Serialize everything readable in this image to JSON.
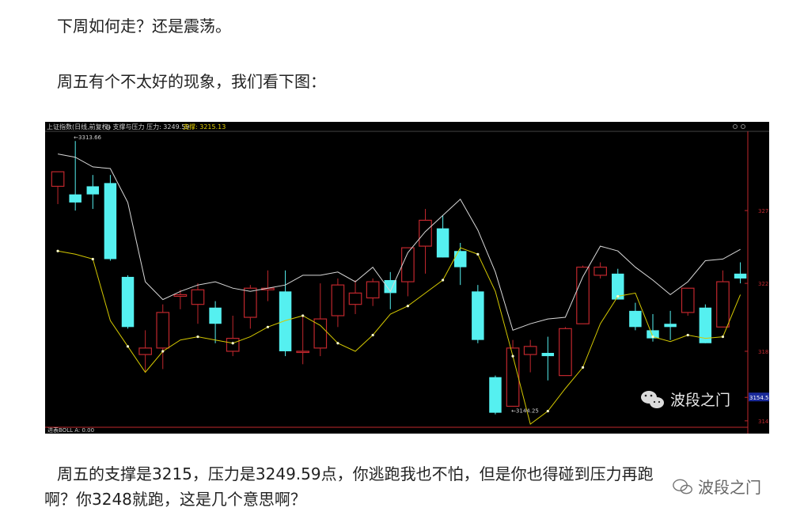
{
  "article": {
    "p1": "下周如何走？还是震荡。",
    "p2": "周五有个不太好的现象，我们看下图：",
    "p3a": "周五的支撑是3215，压力是3249.59点，你逃跑我也不怕，但是你也得碰到压力再跑",
    "p3b": "啊？你3248就跑，这是几个意思啊？"
  },
  "watermark": {
    "chart_label": "波段之门",
    "corner_label": "波段之门",
    "icon": "wechat-icon"
  },
  "chart_header": {
    "index_label": "上证指数(日线,前复权)",
    "indicator": "◎ 支撑与压力 压力: 3249.59",
    "support_label": "支撑: 3215.13",
    "footer_label": "进表BOLL A: 0.00"
  },
  "colors": {
    "background": "#000000",
    "up": "#c0272d",
    "down": "#55f0f0",
    "resistance_line": "#d8d8d8",
    "support_line": "#d4c800",
    "axis": "#c0272d"
  },
  "chart_data": {
    "type": "candlestick",
    "title": "上证指数(日线,前复权)",
    "y_ticks": [
      "327",
      "322",
      "318",
      "3154.5",
      "314"
    ],
    "current_price_label": "3154.5",
    "annotations": [
      {
        "label": "3313.66",
        "near_bar": 1
      },
      {
        "label": "3144.25",
        "near_bar": 26
      }
    ],
    "ylim": [
      3137,
      3318
    ],
    "candles": [
      {
        "o": 3285,
        "h": 3290,
        "l": 3274,
        "c": 3294
      },
      {
        "o": 3280,
        "h": 3313,
        "l": 3270,
        "c": 3275
      },
      {
        "o": 3285,
        "h": 3292,
        "l": 3271,
        "c": 3280
      },
      {
        "o": 3287,
        "h": 3292,
        "l": 3239,
        "c": 3240
      },
      {
        "o": 3229,
        "h": 3230,
        "l": 3197,
        "c": 3198
      },
      {
        "o": 3181,
        "h": 3196,
        "l": 3170,
        "c": 3185
      },
      {
        "o": 3185,
        "h": 3212,
        "l": 3172,
        "c": 3207
      },
      {
        "o": 3217,
        "h": 3221,
        "l": 3209,
        "c": 3218
      },
      {
        "o": 3212,
        "h": 3225,
        "l": 3200,
        "c": 3221
      },
      {
        "o": 3210,
        "h": 3214,
        "l": 3188,
        "c": 3200
      },
      {
        "o": 3183,
        "h": 3205,
        "l": 3180,
        "c": 3191
      },
      {
        "o": 3204,
        "h": 3224,
        "l": 3197,
        "c": 3222
      },
      {
        "o": 3221,
        "h": 3233,
        "l": 3214,
        "c": 3222
      },
      {
        "o": 3220,
        "h": 3233,
        "l": 3180,
        "c": 3183
      },
      {
        "o": 3183,
        "h": 3205,
        "l": 3175,
        "c": 3183
      },
      {
        "o": 3185,
        "h": 3225,
        "l": 3180,
        "c": 3203
      },
      {
        "o": 3205,
        "h": 3228,
        "l": 3198,
        "c": 3224
      },
      {
        "o": 3212,
        "h": 3227,
        "l": 3206,
        "c": 3219
      },
      {
        "o": 3216,
        "h": 3228,
        "l": 3211,
        "c": 3226
      },
      {
        "o": 3227,
        "h": 3232,
        "l": 3209,
        "c": 3219
      },
      {
        "o": 3226,
        "h": 3242,
        "l": 3217,
        "c": 3247
      },
      {
        "o": 3248,
        "h": 3271,
        "l": 3231,
        "c": 3264
      },
      {
        "o": 3259,
        "h": 3267,
        "l": 3243,
        "c": 3241
      },
      {
        "o": 3245,
        "h": 3250,
        "l": 3224,
        "c": 3235
      },
      {
        "o": 3220,
        "h": 3224,
        "l": 3188,
        "c": 3190
      },
      {
        "o": 3167,
        "h": 3168,
        "l": 3144,
        "c": 3145
      },
      {
        "o": 3149,
        "h": 3190,
        "l": 3149,
        "c": 3185
      },
      {
        "o": 3181,
        "h": 3190,
        "l": 3170,
        "c": 3186
      },
      {
        "o": 3182,
        "h": 3192,
        "l": 3165,
        "c": 3180
      },
      {
        "o": 3168,
        "h": 3198,
        "l": 3168,
        "c": 3197
      },
      {
        "o": 3200,
        "h": 3236,
        "l": 3200,
        "c": 3235
      },
      {
        "o": 3230,
        "h": 3238,
        "l": 3228,
        "c": 3235
      },
      {
        "o": 3231,
        "h": 3234,
        "l": 3215,
        "c": 3215
      },
      {
        "o": 3208,
        "h": 3213,
        "l": 3196,
        "c": 3198
      },
      {
        "o": 3196,
        "h": 3206,
        "l": 3189,
        "c": 3191
      },
      {
        "o": 3200,
        "h": 3208,
        "l": 3190,
        "c": 3198
      },
      {
        "o": 3207,
        "h": 3219,
        "l": 3205,
        "c": 3222
      },
      {
        "o": 3210,
        "h": 3212,
        "l": 3190,
        "c": 3188
      },
      {
        "o": 3198,
        "h": 3233,
        "l": 3198,
        "c": 3226
      },
      {
        "o": 3231,
        "h": 3238,
        "l": 3225,
        "c": 3228
      }
    ],
    "resistance_line": [
      3305,
      3303,
      3297,
      3296,
      3275,
      3226,
      3215,
      3220,
      3224,
      3226,
      3222,
      3220,
      3222,
      3224,
      3230,
      3230,
      3232,
      3226,
      3235,
      3220,
      3244,
      3257,
      3267,
      3277,
      3258,
      3232,
      3196,
      3200,
      3203,
      3204,
      3229,
      3248,
      3245,
      3235,
      3227,
      3218,
      3226,
      3239,
      3240,
      3246
    ],
    "support_line": [
      3245,
      3243,
      3240,
      3202,
      3186,
      3170,
      3183,
      3190,
      3192,
      3190,
      3188,
      3192,
      3198,
      3202,
      3205,
      3199,
      3188,
      3183,
      3193,
      3206,
      3211,
      3219,
      3227,
      3247,
      3243,
      3220,
      3180,
      3138,
      3146,
      3160,
      3173,
      3200,
      3217,
      3219,
      3192,
      3189,
      3193,
      3191,
      3192,
      3218
    ]
  }
}
